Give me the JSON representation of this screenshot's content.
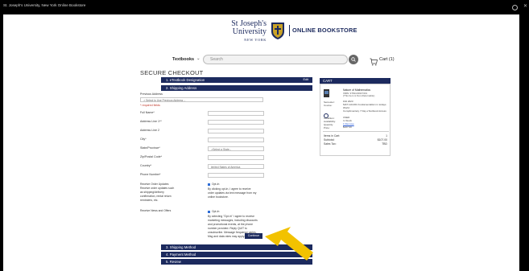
{
  "window": {
    "title": "St. Joseph's University, New York Online Bookstore"
  },
  "logo": {
    "line1": "St Joseph's",
    "line2": "University",
    "line3": "NEW YORK",
    "bookstore": "ONLINE BOOKSTORE"
  },
  "nav": {
    "textbooks_label": "Textbooks",
    "search_placeholder": "Search",
    "cart_label": "Cart (1)"
  },
  "checkout": {
    "title": "SECURE CHECKOUT",
    "sections": [
      {
        "label": "1. eTextbook Designation",
        "edit": "Edit"
      },
      {
        "label": "2. Shipping Address"
      },
      {
        "label": "3. Shipping Method"
      },
      {
        "label": "4. Payment Method"
      },
      {
        "label": "5. Review"
      }
    ],
    "previous_address_label": "Previous Address",
    "previous_address_value": "-- Select to Use Previous Address --",
    "required_note": "* required fields",
    "fields": {
      "full_name": "Full Name*",
      "address1": "Address Line 1**",
      "address2": "Address Line 2",
      "city": "City*",
      "state": "State/Province*",
      "state_value": "--Select a State--",
      "zip": "Zip/Postal Code*",
      "country": "Country*",
      "country_value": "United States of America",
      "phone": "Phone Number*"
    },
    "receive_order_updates": {
      "label": "Receive Order Updates",
      "sublabel_1": "Receive order updates such",
      "sublabel_2": "as shipping/delivery",
      "sublabel_3": "confirmation, rental return",
      "sublabel_4": "reminders, etc.",
      "checkbox_label": "Opt-In",
      "text_1": "By clicking opt-in, I agree to receive",
      "text_2": "order updates via text message from my",
      "text_3": "online bookstore."
    },
    "receive_news": {
      "label": "Receive News and Offers",
      "checkbox_label": "Opt-In",
      "text_1": "By selecting \"Opt-in\" I agree to receive",
      "text_2": "marketing messages, including discounts",
      "text_3": "and promotional events, at the phone",
      "text_4": "number provided. Reply QUIT to",
      "text_5": "unsubscribe. Message frequency varies.",
      "text_6": "Msg and data rates may apply."
    },
    "continue_label": "Continue"
  },
  "cart": {
    "heading": "CART",
    "item_title": "Nature of Mathematics",
    "item_isbn": "ISBN: 9781133947301",
    "item_note": "(This Item is Non-Returnable)",
    "meta": [
      {
        "key": "Semester:",
        "value": "FAll 2023"
      },
      {
        "key": "Course:",
        "value": "MAT 110-001 Fundamentalism in todays World"
      },
      {
        "key": "",
        "value": "Complimentary 7 Day eTextbook Access"
      },
      {
        "key": "Condition:",
        "value": "USED"
      },
      {
        "key": "Availability:",
        "value": "In Stock"
      },
      {
        "key": "Quantity:",
        "value": "1 Remove"
      },
      {
        "key": "Price:",
        "value": "$107.00"
      }
    ],
    "totals": [
      {
        "key": "Items in Cart:",
        "value": "1"
      },
      {
        "key": "Subtotal:",
        "value": "$107.00"
      },
      {
        "key": "Sales Tax:",
        "value": "TBD"
      }
    ]
  },
  "colors": {
    "navy": "#1c2a5e",
    "arrow": "#f2c200",
    "link": "#2a5bd7"
  }
}
